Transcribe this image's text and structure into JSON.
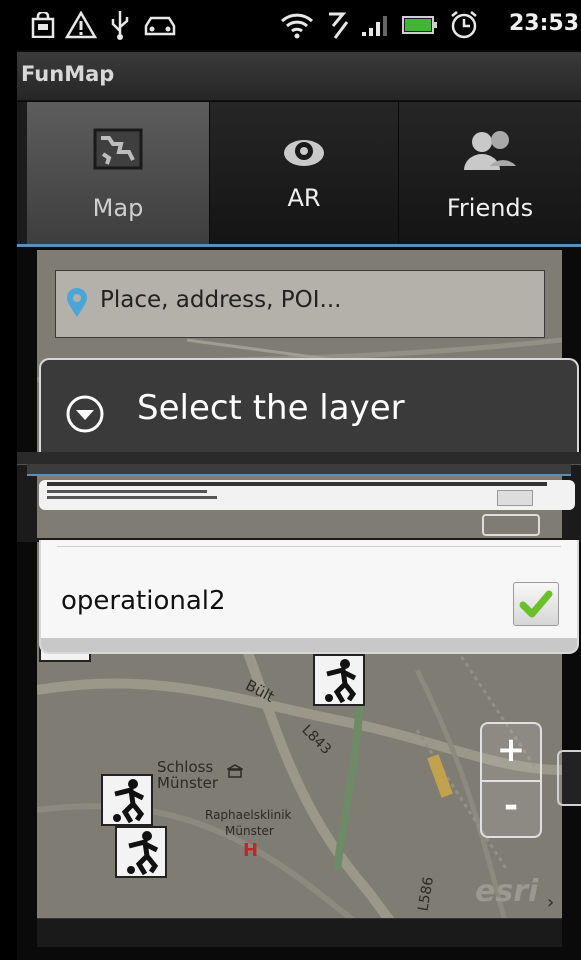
{
  "status": {
    "time": "23:53",
    "icons": [
      "bag-icon",
      "warning-icon",
      "usb-icon",
      "car-icon",
      "wifi-icon",
      "sync-icon",
      "signal-icon",
      "battery-icon",
      "alarm-icon"
    ]
  },
  "app": {
    "title": "FunMap"
  },
  "tabs": [
    {
      "label": "Map",
      "icon": "map-icon",
      "selected": true
    },
    {
      "label": "AR",
      "icon": "eye-icon",
      "selected": false
    },
    {
      "label": "Friends",
      "icon": "friends-icon",
      "selected": false
    }
  ],
  "search": {
    "placeholder": "Place, address, POI..."
  },
  "dialog": {
    "title": "Select the layer",
    "rows": [
      {
        "label": "operational2",
        "checked": true
      }
    ]
  },
  "map": {
    "labels": [
      "Bült",
      "L843",
      "Schloss",
      "Münster",
      "Raphaelsklinik",
      "Münster",
      "H",
      "L586",
      "esri"
    ],
    "zoom_in": "+",
    "zoom_out": "-"
  },
  "colors": {
    "tab_indicator": "#5b8fb5",
    "check": "#6abf2a",
    "hospital": "#c0272d"
  }
}
